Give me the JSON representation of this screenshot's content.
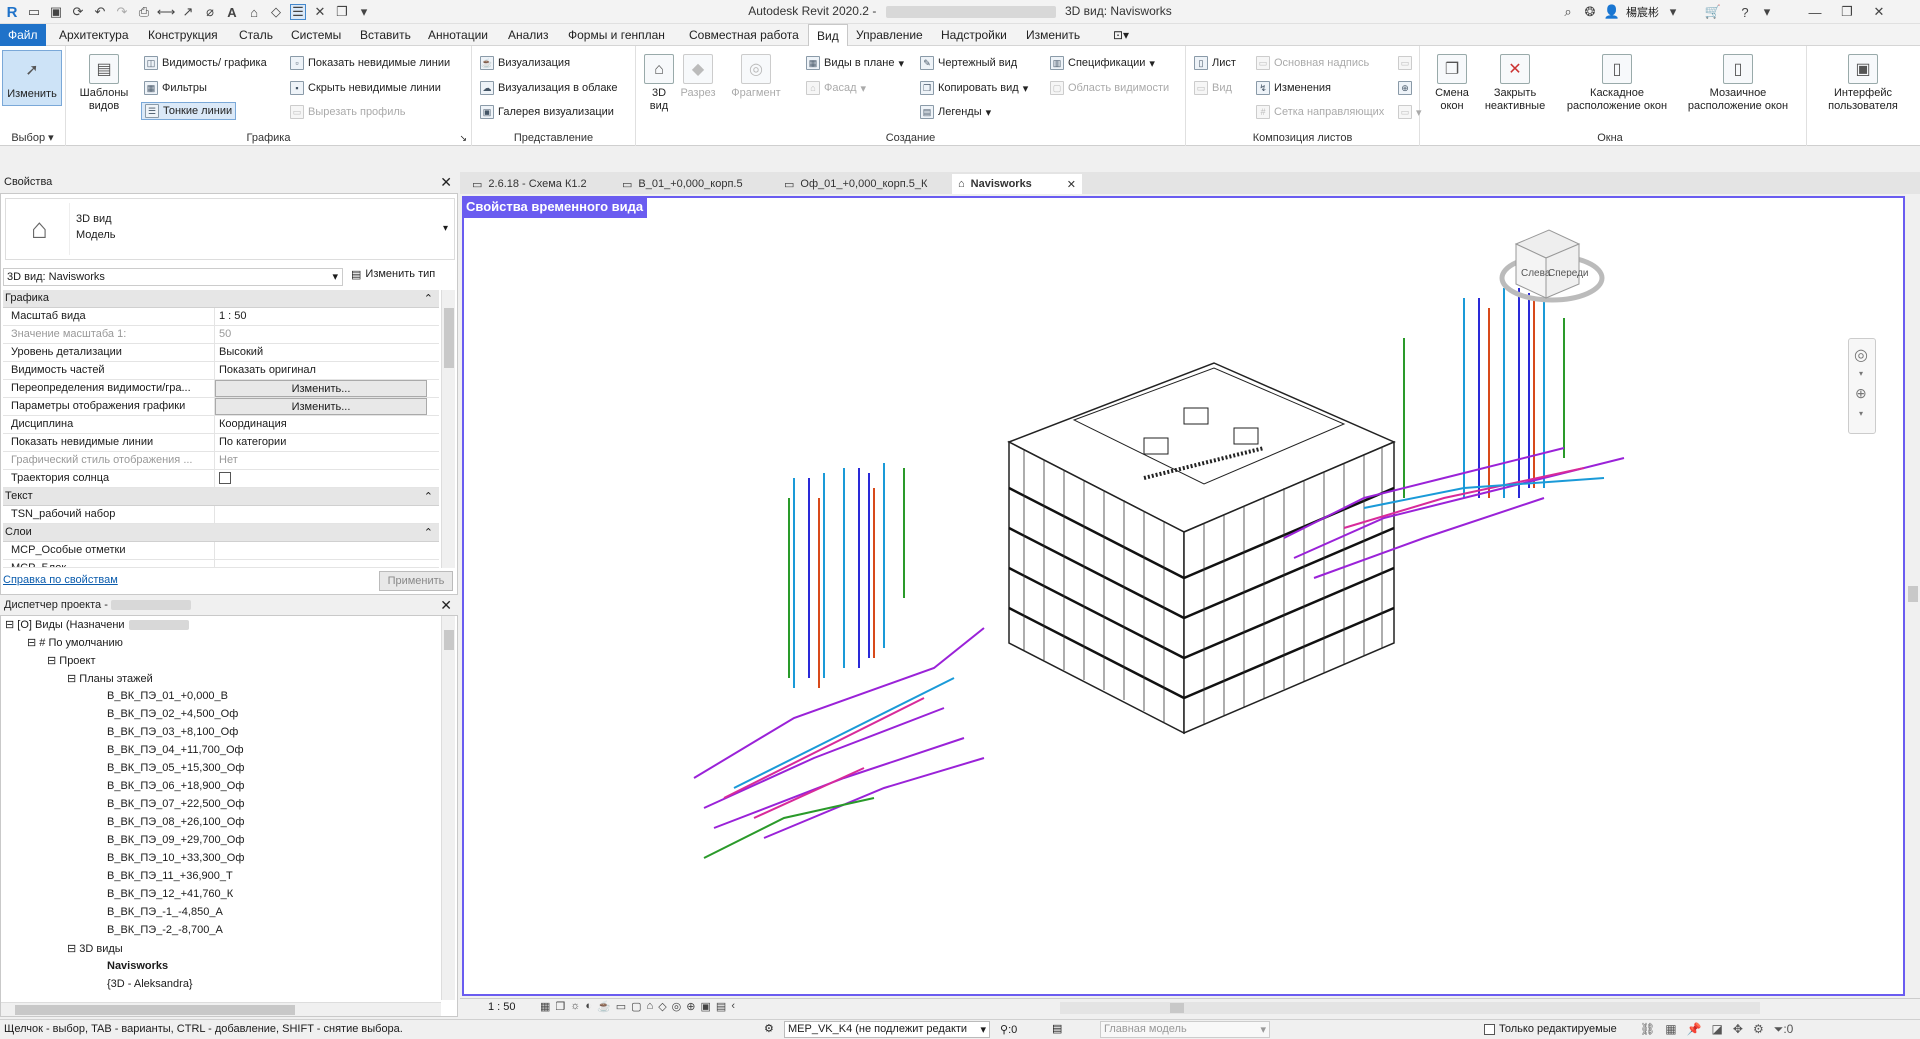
{
  "titlebar": {
    "title": "Autodesk Revit 2020.2 -",
    "view_title": "3D вид: Navisworks",
    "user": "楊宸彬"
  },
  "menu": {
    "tabs": [
      "Файл",
      "Архитектура",
      "Конструкция",
      "Сталь",
      "Системы",
      "Вставить",
      "Аннотации",
      "Анализ",
      "Формы и генплан",
      "Совместная работа",
      "Вид",
      "Управление",
      "Надстройки",
      "Изменить"
    ],
    "active": "Вид"
  },
  "ribbon": {
    "select_group": {
      "modify": "Изменить",
      "label": "Выбор"
    },
    "graphics": {
      "templates": "Шаблоны видов",
      "visibility": "Видимость/ графика",
      "filters": "Фильтры",
      "thin_lines": "Тонкие линии",
      "show_hidden": "Показать невидимые линии",
      "hide_hidden": "Скрыть невидимые линии",
      "cut_profile": "Вырезать профиль",
      "label": "Графика"
    },
    "presentation": {
      "render": "Визуализация",
      "cloud_render": "Визуализация в облаке",
      "gallery": "Галерея визуализации",
      "label": "Представление"
    },
    "create": {
      "view3d": "3D вид",
      "section": "Разрез",
      "callout": "Фрагмент",
      "plan_views": "Виды в плане",
      "elevation": "Фасад",
      "drafting": "Чертежный вид",
      "duplicate": "Копировать вид",
      "legends": "Легенды",
      "schedules": "Спецификации",
      "scope_box": "Область видимости",
      "label": "Создание"
    },
    "sheets": {
      "sheet": "Лист",
      "view": "Вид",
      "title_block": "Основная надпись",
      "revisions": "Изменения",
      "guide_grid": "Сетка направляющих",
      "label": "Композиция листов"
    },
    "windows": {
      "switch": "Смена окон",
      "close_inactive": "Закрыть неактивные",
      "cascade": "Каскадное расположение окон",
      "tile": "Мозаичное расположение окон",
      "ui": "Интерфейс пользователя",
      "label": "Окна"
    }
  },
  "properties": {
    "header": "Свойства",
    "type_line1": "3D вид",
    "type_line2": "Модель",
    "selector": "3D вид: Navisworks",
    "edit_type": "Изменить тип",
    "sections": {
      "graphics": "Графика",
      "text": "Текст",
      "layers": "Слои"
    },
    "rows": [
      {
        "k": "Масштаб вида",
        "v": "1 : 50"
      },
      {
        "k": "Значение масштаба    1:",
        "v": "50"
      },
      {
        "k": "Уровень детализации",
        "v": "Высокий"
      },
      {
        "k": "Видимость частей",
        "v": "Показать оригинал"
      },
      {
        "k": "Переопределения видимости/гра...",
        "v": "Изменить..."
      },
      {
        "k": "Параметры отображения графики",
        "v": "Изменить..."
      },
      {
        "k": "Дисциплина",
        "v": "Координация"
      },
      {
        "k": "Показать невидимые линии",
        "v": "По категории"
      },
      {
        "k": "Графический стиль отображения ...",
        "v": "Нет"
      },
      {
        "k": "Траектория солнца",
        "v": ""
      }
    ],
    "text_rows": [
      {
        "k": "TSN_рабочий набор",
        "v": ""
      }
    ],
    "layer_rows": [
      {
        "k": "MCP_Особые отметки",
        "v": ""
      },
      {
        "k": "MCP_Блок",
        "v": ""
      }
    ],
    "help_link": "Справка по свойствам",
    "apply": "Применить"
  },
  "browser": {
    "header": "Диспетчер проекта -",
    "root": "Виды (Назначени",
    "default": "# По умолчанию",
    "project": "Проект",
    "floor_plans": "Планы этажей",
    "plans": [
      "В_ВК_ПЭ_01_+0,000_В",
      "В_ВК_ПЭ_02_+4,500_Оф",
      "В_ВК_ПЭ_03_+8,100_Оф",
      "В_ВК_ПЭ_04_+11,700_Оф",
      "В_ВК_ПЭ_05_+15,300_Оф",
      "В_ВК_ПЭ_06_+18,900_Оф",
      "В_ВК_ПЭ_07_+22,500_Оф",
      "В_ВК_ПЭ_08_+26,100_Оф",
      "В_ВК_ПЭ_09_+29,700_Оф",
      "В_ВК_ПЭ_10_+33,300_Оф",
      "В_ВК_ПЭ_11_+36,900_Т",
      "В_ВК_ПЭ_12_+41,760_К",
      "В_ВК_ПЭ_-1_-4,850_А",
      "В_ВК_ПЭ_-2_-8,700_А"
    ],
    "views3d": "3D виды",
    "views3d_items": [
      "Navisworks",
      "{3D - Aleksandra}"
    ]
  },
  "viewtabs": [
    "2.6.18 - Схема К1.2",
    "В_01_+0,000_корп.5",
    "Оф_01_+0,000_корп.5_К",
    "Navisworks"
  ],
  "canvas": {
    "temp_view": "Свойства временного вида",
    "cube_left": "Слева",
    "cube_front": "Спереди"
  },
  "viewbar": {
    "scale": "1 : 50"
  },
  "status": {
    "hint": "Щелчок - выбор, TAB - варианты, CTRL - добавление, SHIFT - снятие выбора.",
    "workset": "MEP_VK_K4 (не подлежит редакти",
    "sel_count": ":0",
    "model": "Главная модель",
    "editable_only": "Только редактируемые",
    "filter_count": ":0"
  },
  "colors": {
    "file_tab": "#1f72c9",
    "temp_view": "#6a5cf0"
  }
}
